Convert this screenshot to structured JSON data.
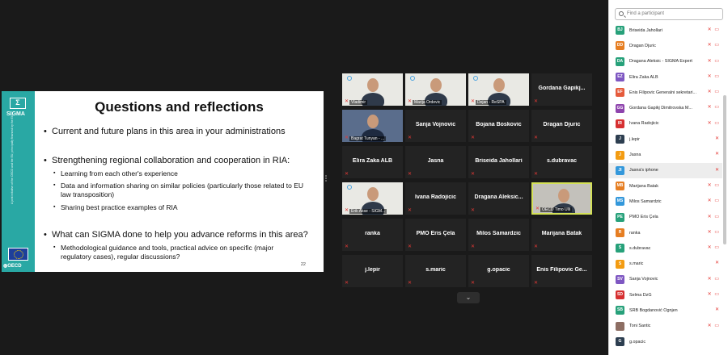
{
  "slide": {
    "title": "Questions and reflections",
    "logo": "Σ",
    "logo_text": "SIGMA",
    "side_text": "A joint initiative of the OECD and the EU, principally financed by the EU",
    "oecd_text": "OECD",
    "slide_number": "22",
    "bullets": [
      {
        "text": "Current and future plans in this area in your administrations",
        "sub": []
      },
      {
        "text": "Strengthening regional collaboration and cooperation in RIA:",
        "sub": [
          "Learning from each other's experience",
          "Data and information sharing on similar policies (particularly those related to EU law transposition)",
          "Sharing best practice examples of RIA"
        ]
      },
      {
        "text": "What can SIGMA done to help you advance reforms in this area?",
        "sub": [
          "Methodological guidance and tools, practical advice on specific (major regulatory cases), regular discussions?"
        ]
      }
    ]
  },
  "tiles": [
    {
      "name": "",
      "caption": "Vladimir",
      "video": "wall"
    },
    {
      "name": "",
      "caption": "Marija Ordevic",
      "video": "wall"
    },
    {
      "name": "",
      "caption": "Dejan - ReSPA",
      "video": "wall"
    },
    {
      "name": "Gordana Gapikj...",
      "caption": "",
      "video": ""
    },
    {
      "name": "",
      "caption": "Bagrat Tunyan - ...",
      "video": "blue"
    },
    {
      "name": "Sanja Vojnovic",
      "caption": "",
      "video": ""
    },
    {
      "name": "Bojana Boskovic",
      "caption": "",
      "video": ""
    },
    {
      "name": "Dragan Djuric",
      "caption": "",
      "video": ""
    },
    {
      "name": "Elira Zaka ALB",
      "caption": "",
      "video": ""
    },
    {
      "name": "Jasna",
      "caption": "",
      "video": ""
    },
    {
      "name": "Briseida Jahollari",
      "caption": "",
      "video": ""
    },
    {
      "name": "s.dubravac",
      "caption": "",
      "video": ""
    },
    {
      "name": "",
      "caption": "Erik Akse - SIGM...",
      "video": "wall"
    },
    {
      "name": "Ivana Radojicic",
      "caption": "",
      "video": ""
    },
    {
      "name": "Dragana Aleksic...",
      "caption": "",
      "video": ""
    },
    {
      "name": "",
      "caption": "OECD Timo Ulli",
      "video": "room"
    },
    {
      "name": "ranka",
      "caption": "",
      "video": ""
    },
    {
      "name": "PMO Eris Çela",
      "caption": "",
      "video": ""
    },
    {
      "name": "Milos Samardzic",
      "caption": "",
      "video": ""
    },
    {
      "name": "Marijana Batak",
      "caption": "",
      "video": ""
    },
    {
      "name": "j.lepir",
      "caption": "",
      "video": ""
    },
    {
      "name": "s.maric",
      "caption": "",
      "video": ""
    },
    {
      "name": "g.opacic",
      "caption": "",
      "video": ""
    },
    {
      "name": "Enis Filipovic Ge...",
      "caption": "",
      "video": ""
    }
  ],
  "panel": {
    "search_placeholder": "Find a participant",
    "participants": [
      {
        "initials": "BJ",
        "name": "Briseida Jahollari",
        "color": "#27a17a",
        "icons": "🎤̸ ⧄"
      },
      {
        "initials": "DD",
        "name": "Dragan Djuric",
        "color": "#e67e22",
        "icons": "🎤̸ ⧄"
      },
      {
        "initials": "DA",
        "name": "Dragana Aleksic - SIGMA Expert",
        "color": "#27a17a",
        "icons": "🎤̸ ⧄"
      },
      {
        "initials": "EZ",
        "name": "Elira Zaka ALB",
        "color": "#7e57c2",
        "icons": "🎤̸ ⧄"
      },
      {
        "initials": "EF",
        "name": "Enis Filipovic Generalni sekretari...",
        "color": "#e55b3c",
        "icons": "🎤̸ ⧄"
      },
      {
        "initials": "GG",
        "name": "Gordana Gapikj Dimitrovska M...",
        "color": "#8e44ad",
        "icons": "🎤̸ ⧄"
      },
      {
        "initials": "IR",
        "name": "Ivana Radojicic",
        "color": "#d63031",
        "icons": "🎤̸ ⧄"
      },
      {
        "initials": "J",
        "name": "j.lepir",
        "color": "#2d3e50",
        "icons": "🎤̸"
      },
      {
        "initials": "J",
        "name": "Jasna",
        "color": "#f39c12",
        "icons": "🎤̸"
      },
      {
        "initials": "JI",
        "name": "Jasna's iphone",
        "color": "#3498db",
        "icons": "🎤̸"
      },
      {
        "initials": "MB",
        "name": "Marijana Batak",
        "color": "#e67e22",
        "icons": "🎤̸ ⧄"
      },
      {
        "initials": "MS",
        "name": "Milos Samardzic",
        "color": "#3498db",
        "icons": "🎤̸ ⧄"
      },
      {
        "initials": "PE",
        "name": "PMO Eris Çela",
        "color": "#27a17a",
        "icons": "🎤̸ ⧄"
      },
      {
        "initials": "R",
        "name": "ranka",
        "color": "#e67e22",
        "icons": "🎤̸ ⧄"
      },
      {
        "initials": "S",
        "name": "s.dubravac",
        "color": "#27a17a",
        "icons": "🎤̸ ⧄"
      },
      {
        "initials": "S",
        "name": "s.maric",
        "color": "#f39c12",
        "icons": "🎤̸"
      },
      {
        "initials": "SV",
        "name": "Sanja Vojnovic",
        "color": "#7e57c2",
        "icons": "🎤̸ ⧄"
      },
      {
        "initials": "SD",
        "name": "Selma DzG",
        "color": "#d63031",
        "icons": "🎤̸ ⧄"
      },
      {
        "initials": "SB",
        "name": "SRB Bogdanović Ognjen",
        "color": "#27a17a",
        "icons": "🎤̸"
      },
      {
        "initials": "",
        "name": "Toni Santic",
        "color": "#8d6e63",
        "icons": "🎤̸ ⧄"
      },
      {
        "initials": "G",
        "name": "g.opacic",
        "color": "#2d3e50",
        "icons": ""
      }
    ]
  }
}
